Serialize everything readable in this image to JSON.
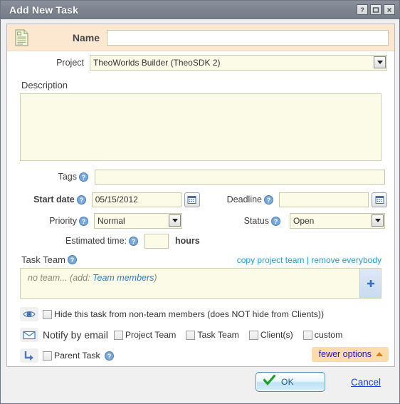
{
  "window": {
    "title": "Add New Task",
    "buttons": {
      "help": "help-button",
      "maximize": "maximize-button",
      "close": "close-button"
    }
  },
  "form": {
    "name": {
      "label": "Name",
      "value": "",
      "icon": "document-icon"
    },
    "project": {
      "label": "Project",
      "selected": "TheoWorlds Builder (TheoSDK 2)",
      "options": [
        "TheoWorlds Builder (TheoSDK 2)"
      ]
    },
    "description": {
      "label": "Description",
      "value": ""
    },
    "tags": {
      "label": "Tags",
      "value": ""
    },
    "start_date": {
      "label": "Start date",
      "value": "05/15/2012"
    },
    "deadline": {
      "label": "Deadline",
      "value": ""
    },
    "priority": {
      "label": "Priority",
      "selected": "Normal",
      "options": [
        "Normal"
      ]
    },
    "status": {
      "label": "Status",
      "selected": "Open",
      "options": [
        "Open"
      ]
    },
    "estimated_time": {
      "label": "Estimated time:",
      "value": "",
      "unit": "hours"
    },
    "task_team": {
      "label": "Task Team",
      "copy_link": "copy project team",
      "separator": "|",
      "remove_link": "remove everybody",
      "placeholder_prefix": "no team... (add: ",
      "placeholder_link": "Team members",
      "placeholder_suffix": ")",
      "add_button": "+"
    },
    "options": {
      "hide_task": {
        "label": "Hide this task from non-team members (does NOT hide from Clients))",
        "checked": false,
        "icon": "eye-icon"
      },
      "notify": {
        "label": "Notify by email",
        "icon": "envelope-icon",
        "items": [
          {
            "label": "Project Team",
            "checked": false
          },
          {
            "label": "Task Team",
            "checked": false
          },
          {
            "label": "Client(s)",
            "checked": false
          },
          {
            "label": "custom",
            "checked": false
          }
        ]
      },
      "parent_task": {
        "label": "Parent Task",
        "checked": false,
        "icon": "subtask-arrow-icon"
      }
    },
    "fewer_options": {
      "label": "fewer options"
    }
  },
  "footer": {
    "ok_label": "OK",
    "cancel_label": "Cancel"
  },
  "colors": {
    "titlebar": "#7d838f",
    "name_strip": "#fce8d1",
    "field_bg": "#fbfbe8",
    "link_blue": "#1d9bd7",
    "cancel_blue": "#1b3fd4",
    "fewer_bg": "#fcdcaa",
    "orange_arrow": "#e87e12",
    "ok_check_green": "#1f9f28"
  }
}
